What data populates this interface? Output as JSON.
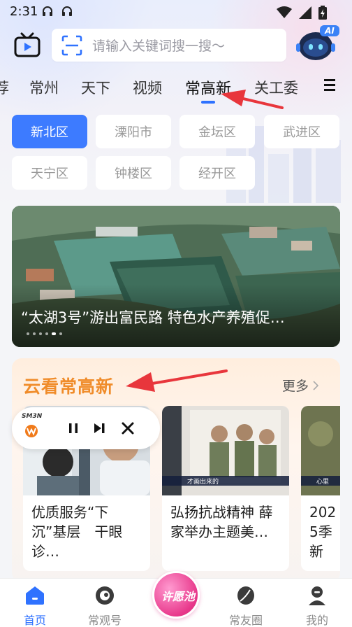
{
  "status": {
    "time": "2:31"
  },
  "search": {
    "placeholder": "请输入关键词搜一搜～"
  },
  "ai": {
    "badge": "AI"
  },
  "tabs": [
    {
      "label": "荐"
    },
    {
      "label": "常州"
    },
    {
      "label": "天下"
    },
    {
      "label": "视频"
    },
    {
      "label": "常高新",
      "active": true
    },
    {
      "label": "关工委"
    }
  ],
  "districts": [
    {
      "label": "新北区",
      "active": true
    },
    {
      "label": "溧阳市"
    },
    {
      "label": "金坛区"
    },
    {
      "label": "武进区"
    },
    {
      "label": "天宁区"
    },
    {
      "label": "钟楼区"
    },
    {
      "label": "经开区"
    }
  ],
  "banner": {
    "title": "“太湖3号”游出富民路 特色水产养殖促…"
  },
  "cloud": {
    "title": "云看常高新",
    "more": "更多",
    "videos": [
      {
        "title": "优质服务“下沉”基层　干眼诊…"
      },
      {
        "title": "弘扬抗战精神 薛家举办主题美…",
        "caption": "才画出来的"
      },
      {
        "title": "2025季新",
        "caption": "心里"
      }
    ]
  },
  "player": {
    "logo": "SM3N"
  },
  "nav": {
    "items": [
      {
        "label": "首页",
        "active": true
      },
      {
        "label": "常观号"
      },
      {
        "label": "常友圈"
      },
      {
        "label": "我的"
      }
    ],
    "wish": "许愿池"
  },
  "colors": {
    "accent": "#2f72ff",
    "active_chip": "#3d7bff",
    "cloud_title": "#f08c2a",
    "annotation_arrow": "#e8363c"
  }
}
